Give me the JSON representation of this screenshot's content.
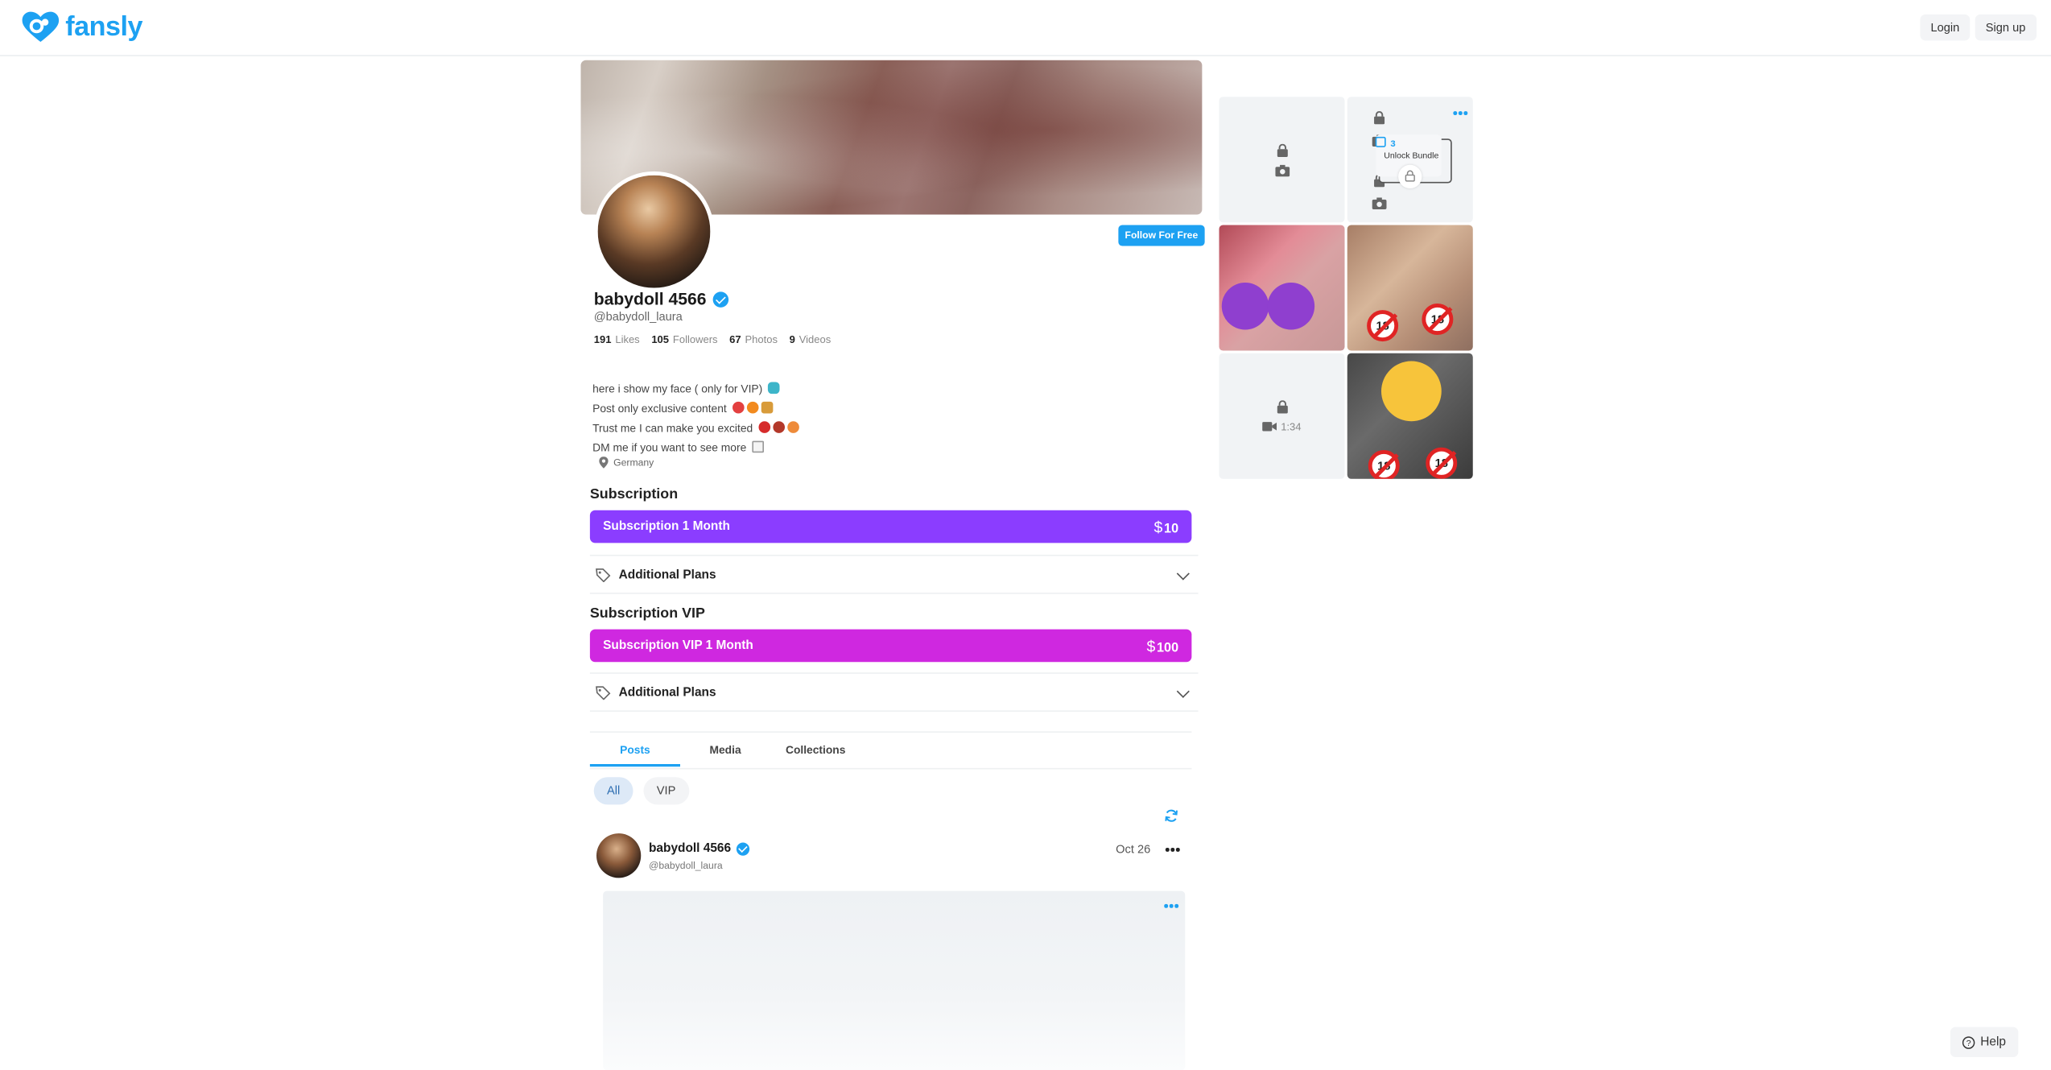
{
  "brand": {
    "name": "fansly",
    "color": "#1da1f2"
  },
  "topbar": {
    "login_label": "Login",
    "signup_label": "Sign up"
  },
  "profile": {
    "display_name": "babydoll 4566",
    "handle": "@babydoll_laura",
    "verified": true,
    "follow_label": "Follow For Free",
    "stats": [
      {
        "value": "191",
        "label": "Likes"
      },
      {
        "value": "105",
        "label": "Followers"
      },
      {
        "value": "67",
        "label": "Photos"
      },
      {
        "value": "9",
        "label": "Videos"
      }
    ],
    "bio": [
      "here i show my face ( only for VIP)",
      "Post only exclusive content",
      "Trust me I can make you excited",
      "DM me if you want to see more"
    ],
    "location": "Germany"
  },
  "subscriptions": [
    {
      "section_title": "Subscription",
      "plan_label": "Subscription 1 Month",
      "currency": "$",
      "price": "10",
      "color": "#8b3dff",
      "additional_label": "Additional Plans"
    },
    {
      "section_title": "Subscription VIP",
      "plan_label": "Subscription VIP 1 Month",
      "currency": "$",
      "price": "100",
      "color": "#cf28e0",
      "additional_label": "Additional Plans"
    }
  ],
  "tabs": [
    {
      "label": "Posts",
      "active": true
    },
    {
      "label": "Media",
      "active": false
    },
    {
      "label": "Collections",
      "active": false
    }
  ],
  "filters": [
    {
      "label": "All",
      "active": true
    },
    {
      "label": "VIP",
      "active": false
    }
  ],
  "post": {
    "author": "babydoll 4566",
    "handle": "@babydoll_laura",
    "date": "Oct 26"
  },
  "media_grid": {
    "bundle_count": "3",
    "bundle_label": "Unlock Bundle",
    "video_duration": "1:34",
    "badge_18": "18"
  },
  "help_label": "Help"
}
